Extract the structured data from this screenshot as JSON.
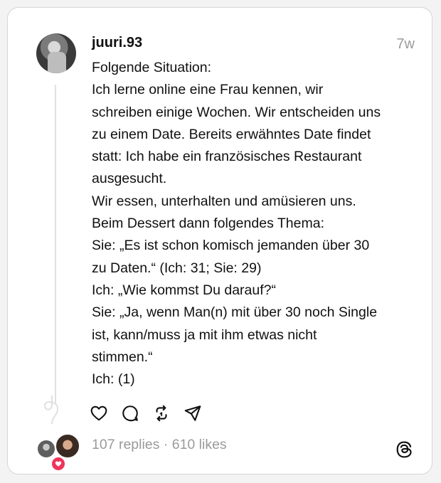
{
  "post": {
    "username": "juuri.93",
    "time": "7w",
    "lines": [
      "Folgende Situation:",
      "Ich lerne online eine Frau kennen, wir",
      "schreiben einige Wochen. Wir entscheiden uns",
      "zu einem Date. Bereits erwähntes Date findet",
      "statt: Ich habe ein französisches Restaurant",
      "ausgesucht.",
      "Wir essen, unterhalten und amüsieren uns.",
      "Beim Dessert dann folgendes Thema:",
      "Sie: „Es ist schon komisch jemanden über 30",
      "zu Daten.“ (Ich: 31; Sie: 29)",
      "Ich: „Wie kommst Du darauf?“",
      "Sie: „Ja, wenn Man(n) mit über 30 noch Single",
      "ist, kann/muss ja mit ihm etwas nicht",
      "stimmen.“",
      "Ich: (1)"
    ],
    "stats": "107 replies · 610 likes"
  },
  "actions": {
    "icons": [
      "heart-icon",
      "comment-icon",
      "repost-icon",
      "share-icon"
    ]
  },
  "colors": {
    "text": "#101010",
    "muted": "#9a9a9a",
    "border": "#d6d6d6",
    "like_badge": "#f0335a"
  }
}
